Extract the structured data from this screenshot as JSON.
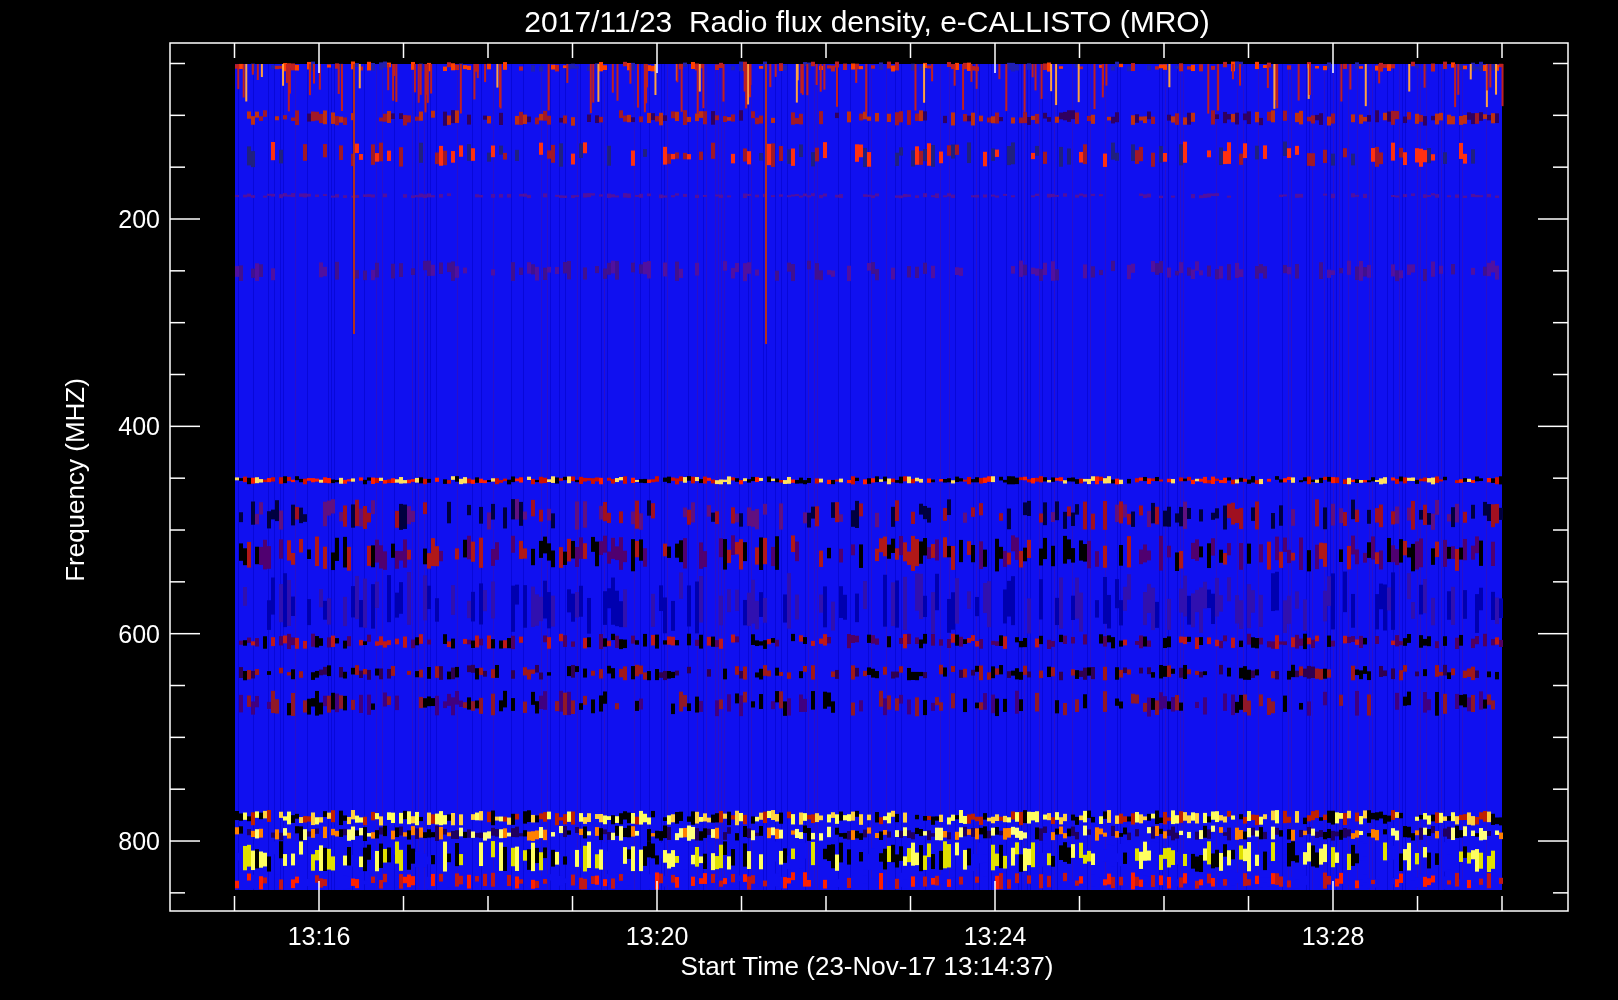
{
  "title": "2017/11/23  Radio flux density, e-CALLISTO (MRO)",
  "y_axis": {
    "label": "Frequency (MHZ)",
    "ticks": [
      "200",
      "400",
      "600",
      "800"
    ]
  },
  "x_axis": {
    "label": "Start Time (23-Nov-17 13:14:37)",
    "ticks": [
      "13:16",
      "13:20",
      "13:24",
      "13:28"
    ]
  }
}
